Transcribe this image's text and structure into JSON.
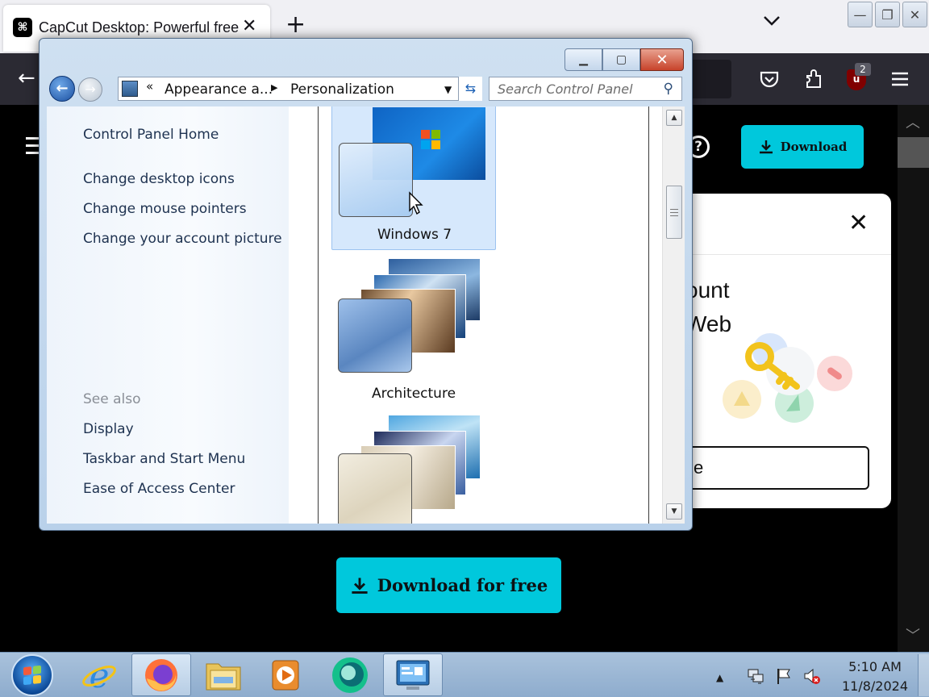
{
  "browser": {
    "tab_title": "CapCut Desktop: Powerful free",
    "tab_favicon": "capcut-logo",
    "ublock_badge": "2"
  },
  "webpage": {
    "download_button": "Download",
    "card_line1": "ount",
    "card_line2": "Web",
    "card_button_text": "e",
    "download_free_button": "Download for free",
    "accent_color": "#00c8dc"
  },
  "control_panel": {
    "breadcrumb_prefix": "«",
    "breadcrumb_1": "Appearance a...",
    "breadcrumb_2": "Personalization",
    "search_placeholder": "Search Control Panel",
    "sidebar": {
      "home": "Control Panel Home",
      "links": [
        "Change desktop icons",
        "Change mouse pointers",
        "Change your account picture"
      ],
      "see_also_heading": "See also",
      "see_also": [
        "Display",
        "Taskbar and Start Menu",
        "Ease of Access Center"
      ]
    },
    "themes": [
      {
        "label": "Windows 7",
        "selected": true
      },
      {
        "label": "Architecture",
        "selected": false
      },
      {
        "label": "",
        "selected": false
      }
    ]
  },
  "taskbar": {
    "apps": [
      "internet-explorer",
      "firefox",
      "file-explorer",
      "media-player",
      "capcut",
      "control-panel"
    ],
    "clock_time": "5:10 AM",
    "clock_date": "11/8/2024"
  }
}
